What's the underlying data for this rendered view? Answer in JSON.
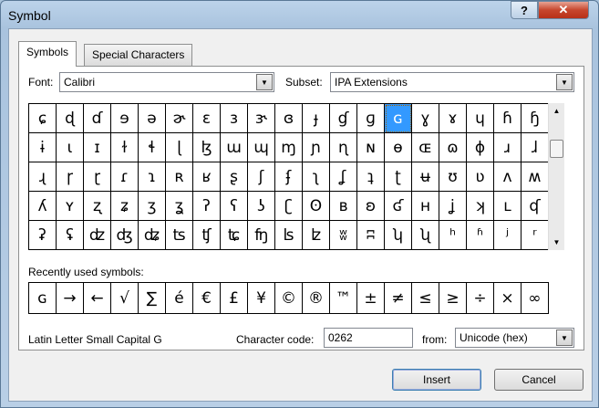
{
  "window": {
    "title": "Symbol",
    "help": "?",
    "close": "✕"
  },
  "tabs": [
    {
      "label": "Symbols"
    },
    {
      "label": "Special Characters"
    }
  ],
  "font": {
    "label": "Font:",
    "value": "Calibri"
  },
  "subset": {
    "label": "Subset:",
    "value": "IPA Extensions"
  },
  "symbols": [
    "ɕ",
    "ɖ",
    "ɗ",
    "ɘ",
    "ə",
    "ɚ",
    "ɛ",
    "ɜ",
    "ɝ",
    "ɞ",
    "ɟ",
    "ɠ",
    "ɡ",
    "ɢ",
    "ɣ",
    "ɤ",
    "ɥ",
    "ɦ",
    "ɧ",
    "ɨ",
    "ɩ",
    "ɪ",
    "ɫ",
    "ɬ",
    "ɭ",
    "ɮ",
    "ɯ",
    "ɰ",
    "ɱ",
    "ɲ",
    "ɳ",
    "ɴ",
    "ɵ",
    "ɶ",
    "ɷ",
    "ɸ",
    "ɹ",
    "ɺ",
    "ɻ",
    "ɼ",
    "ɽ",
    "ɾ",
    "ɿ",
    "ʀ",
    "ʁ",
    "ʂ",
    "ʃ",
    "ʄ",
    "ʅ",
    "ʆ",
    "ʇ",
    "ʈ",
    "ʉ",
    "ʊ",
    "ʋ",
    "ʌ",
    "ʍ",
    "ʎ",
    "ʏ",
    "ʐ",
    "ʑ",
    "ʒ",
    "ʓ",
    "ʔ",
    "ʕ",
    "ʖ",
    "ʗ",
    "ʘ",
    "ʙ",
    "ʚ",
    "ʛ",
    "ʜ",
    "ʝ",
    "ʞ",
    "ʟ",
    "ʠ",
    "ʡ",
    "ʢ",
    "ʣ",
    "ʤ",
    "ʥ",
    "ʦ",
    "ʧ",
    "ʨ",
    "ʩ",
    "ʪ",
    "ʫ",
    "ʬ",
    "ʭ",
    "ʮ",
    "ʯ",
    "ʰ",
    "ʱ",
    "ʲ",
    "ʳ"
  ],
  "selected_index": 13,
  "recent": {
    "label": "Recently used symbols:",
    "items": [
      "ɢ",
      "→",
      "←",
      "√",
      "∑",
      "é",
      "€",
      "£",
      "¥",
      "©",
      "®",
      "™",
      "±",
      "≠",
      "≤",
      "≥",
      "÷",
      "×",
      "∞"
    ]
  },
  "char_name": "Latin Letter Small Capital G",
  "char_code": {
    "label": "Character code:",
    "value": "0262"
  },
  "from": {
    "label": "from:",
    "value": "Unicode (hex)"
  },
  "buttons": {
    "insert": "Insert",
    "cancel": "Cancel"
  }
}
